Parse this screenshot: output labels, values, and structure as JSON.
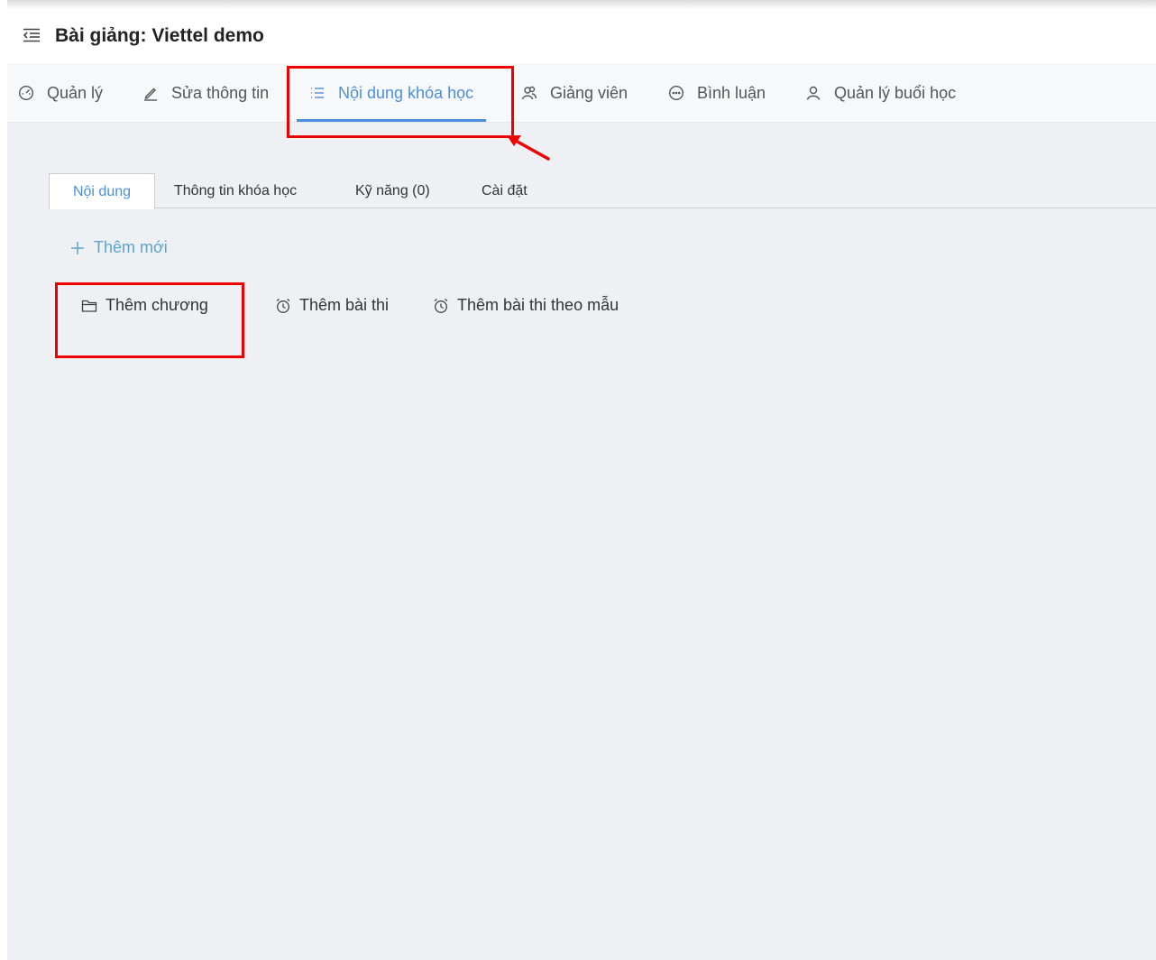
{
  "header": {
    "title": "Bài giảng: Viettel demo",
    "menu_icon": "indent-menu-icon"
  },
  "tabs": [
    {
      "label": "Quản lý",
      "icon": "dashboard-icon"
    },
    {
      "label": "Sửa thông tin",
      "icon": "edit-pen-icon"
    },
    {
      "label": "Nội dung khóa học",
      "icon": "list-icon",
      "active": true
    },
    {
      "label": "Giảng viên",
      "icon": "users-icon"
    },
    {
      "label": "Bình luận",
      "icon": "comment-icon"
    },
    {
      "label": "Quản lý buổi học",
      "icon": "user-icon"
    }
  ],
  "subtabs": [
    {
      "label": "Nội dung",
      "active": true
    },
    {
      "label": "Thông tin khóa học"
    },
    {
      "label": "Kỹ năng (0)"
    },
    {
      "label": "Cài đặt"
    }
  ],
  "add_new": {
    "label": "Thêm mới",
    "icon": "plus-icon"
  },
  "actions": [
    {
      "label": "Thêm chương",
      "icon": "folder-icon"
    },
    {
      "label": "Thêm bài thi",
      "icon": "alarm-clock-icon"
    },
    {
      "label": "Thêm bài thi theo mẫu",
      "icon": "alarm-clock-icon"
    }
  ],
  "colors": {
    "accent": "#4a8fe0",
    "annotation": "#ee0000",
    "add_link": "#5aa5c8",
    "content_bg": "#eef0f4"
  }
}
